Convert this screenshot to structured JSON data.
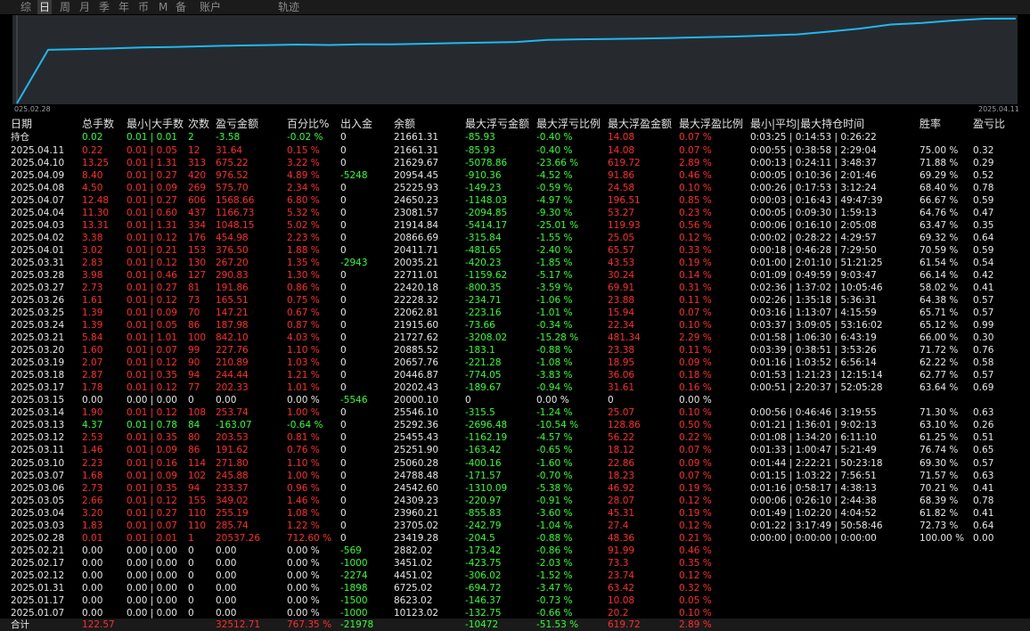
{
  "tabs": [
    {
      "label": "综",
      "active": false
    },
    {
      "label": "日",
      "active": true
    },
    {
      "label": "周",
      "active": false
    },
    {
      "label": "月",
      "active": false
    },
    {
      "label": "季",
      "active": false
    },
    {
      "label": "年",
      "active": false
    },
    {
      "label": "币",
      "active": false
    },
    {
      "label": "M",
      "active": false
    },
    {
      "label": "备",
      "active": false
    },
    {
      "label": "账户",
      "active": false
    },
    {
      "label": "轨迹",
      "active": false
    }
  ],
  "chart_data": {
    "type": "line",
    "x_start_label": "025.02.28",
    "x_end_label": "2025.04.11",
    "x": [
      "2025.02.28",
      "2025.03.03",
      "2025.03.04",
      "2025.03.05",
      "2025.03.06",
      "2025.03.07",
      "2025.03.10",
      "2025.03.11",
      "2025.03.12",
      "2025.03.13",
      "2025.03.14",
      "2025.03.15",
      "2025.03.17",
      "2025.03.18",
      "2025.03.19",
      "2025.03.20",
      "2025.03.21",
      "2025.03.24",
      "2025.03.25",
      "2025.03.26",
      "2025.03.27",
      "2025.03.28",
      "2025.03.31",
      "2025.04.01",
      "2025.04.02",
      "2025.04.03",
      "2025.04.04",
      "2025.04.07",
      "2025.04.08",
      "2025.04.09",
      "2025.04.10",
      "2025.04.11"
    ],
    "y": [
      20537.26,
      20823,
      21078,
      21427,
      21660,
      21906,
      22178,
      22370,
      22573,
      22410,
      22664,
      22664,
      22866,
      23111,
      23321,
      23549,
      24391,
      24579,
      24726,
      24892,
      25084,
      25375,
      25642,
      26021,
      26476,
      27524,
      28691,
      30260,
      30836,
      31813,
      32488,
      32520
    ],
    "line_color": "#1fb8f0"
  },
  "table": {
    "headers": [
      "日期",
      "总手数",
      "最小|大手数",
      "次数",
      "盈亏金额",
      "百分比%",
      "出入金",
      "余额",
      "最大浮亏金额",
      "最大浮亏比例",
      "最大浮盈金额",
      "最大浮盈比例",
      "最小|平均|最大持仓时间",
      "胜率",
      "盈亏比"
    ],
    "position_row": [
      "持仓",
      "0.02",
      "0.01 | 0.01",
      "2",
      "-3.58",
      "-0.02 %",
      "0",
      "21661.31",
      "-85.93",
      "-0.40 %",
      "14.08",
      "0.07 %",
      "0:03:25 | 0:14:53 | 0:26:22",
      "",
      ""
    ],
    "rows": [
      [
        "2025.04.11",
        "0.22",
        "0.01 | 0.05",
        "12",
        "31.64",
        "0.15 %",
        "0",
        "21661.31",
        "-85.93",
        "-0.40 %",
        "14.08",
        "0.07 %",
        "0:00:55 | 0:38:58 | 2:29:04",
        "75.00 %",
        "0.32"
      ],
      [
        "2025.04.10",
        "13.25",
        "0.01 | 1.31",
        "313",
        "675.22",
        "3.22 %",
        "0",
        "21629.67",
        "-5078.86",
        "-23.66 %",
        "619.72",
        "2.89 %",
        "0:00:13 | 0:24:11 | 3:48:37",
        "71.88 %",
        "0.29"
      ],
      [
        "2025.04.09",
        "8.40",
        "0.01 | 0.27",
        "420",
        "976.52",
        "4.89 %",
        "-5248",
        "20954.45",
        "-910.36",
        "-4.52 %",
        "91.86",
        "0.46 %",
        "0:00:05 | 0:10:36 | 2:01:46",
        "69.29 %",
        "0.52"
      ],
      [
        "2025.04.08",
        "4.50",
        "0.01 | 0.09",
        "269",
        "575.70",
        "2.34 %",
        "0",
        "25225.93",
        "-149.23",
        "-0.59 %",
        "24.58",
        "0.10 %",
        "0:00:26 | 0:17:53 | 3:12:24",
        "68.40 %",
        "0.78"
      ],
      [
        "2025.04.07",
        "12.48",
        "0.01 | 0.27",
        "606",
        "1568.66",
        "6.80 %",
        "0",
        "24650.23",
        "-1148.03",
        "-4.97 %",
        "196.51",
        "0.85 %",
        "0:00:03 | 0:16:43 | 49:47:39",
        "66.67 %",
        "0.59"
      ],
      [
        "2025.04.04",
        "11.30",
        "0.01 | 0.60",
        "437",
        "1166.73",
        "5.32 %",
        "0",
        "23081.57",
        "-2094.85",
        "-9.30 %",
        "53.27",
        "0.23 %",
        "0:00:05 | 0:09:30 | 1:59:13",
        "64.76 %",
        "0.47"
      ],
      [
        "2025.04.03",
        "13.31",
        "0.01 | 1.31",
        "334",
        "1048.15",
        "5.02 %",
        "0",
        "21914.84",
        "-5414.17",
        "-25.01 %",
        "119.93",
        "0.56 %",
        "0:00:06 | 0:16:10 | 2:05:08",
        "63.47 %",
        "0.35"
      ],
      [
        "2025.04.02",
        "3.38",
        "0.01 | 0.12",
        "176",
        "454.98",
        "2.23 %",
        "0",
        "20866.69",
        "-315.84",
        "-1.55 %",
        "25.05",
        "0.12 %",
        "0:00:02 | 0:28:22 | 4:29:57",
        "69.32 %",
        "0.64"
      ],
      [
        "2025.04.01",
        "3.02",
        "0.01 | 0.21",
        "153",
        "376.50",
        "1.88 %",
        "0",
        "20411.71",
        "-481.65",
        "-2.40 %",
        "65.57",
        "0.33 %",
        "0:00:18 | 0:46:28 | 7:29:50",
        "70.59 %",
        "0.59"
      ],
      [
        "2025.03.31",
        "2.83",
        "0.01 | 0.12",
        "130",
        "267.20",
        "1.35 %",
        "-2943",
        "20035.21",
        "-420.23",
        "-1.85 %",
        "43.53",
        "0.19 %",
        "0:01:00 | 2:01:10 | 51:21:25",
        "61.54 %",
        "0.54"
      ],
      [
        "2025.03.28",
        "3.98",
        "0.01 | 0.46",
        "127",
        "290.83",
        "1.30 %",
        "0",
        "22711.01",
        "-1159.62",
        "-5.17 %",
        "30.24",
        "0.14 %",
        "0:01:09 | 0:49:59 | 9:03:47",
        "66.14 %",
        "0.42"
      ],
      [
        "2025.03.27",
        "2.73",
        "0.01 | 0.27",
        "81",
        "191.86",
        "0.86 %",
        "0",
        "22420.18",
        "-800.35",
        "-3.59 %",
        "69.91",
        "0.31 %",
        "0:02:36 | 1:37:02 | 10:05:46",
        "58.02 %",
        "0.41"
      ],
      [
        "2025.03.26",
        "1.61",
        "0.01 | 0.12",
        "73",
        "165.51",
        "0.75 %",
        "0",
        "22228.32",
        "-234.71",
        "-1.06 %",
        "23.88",
        "0.11 %",
        "0:02:26 | 1:35:18 | 5:36:31",
        "64.38 %",
        "0.57"
      ],
      [
        "2025.03.25",
        "1.39",
        "0.01 | 0.09",
        "70",
        "147.21",
        "0.67 %",
        "0",
        "22062.81",
        "-223.16",
        "-1.01 %",
        "15.94",
        "0.07 %",
        "0:03:16 | 1:13:07 | 4:15:59",
        "65.71 %",
        "0.57"
      ],
      [
        "2025.03.24",
        "1.39",
        "0.01 | 0.05",
        "86",
        "187.98",
        "0.87 %",
        "0",
        "21915.60",
        "-73.66",
        "-0.34 %",
        "22.34",
        "0.10 %",
        "0:03:37 | 3:09:05 | 53:16:02",
        "65.12 %",
        "0.99"
      ],
      [
        "2025.03.21",
        "5.84",
        "0.01 | 1.01",
        "100",
        "842.10",
        "4.03 %",
        "0",
        "21727.62",
        "-3208.02",
        "-15.28 %",
        "481.34",
        "2.29 %",
        "0:01:58 | 1:06:30 | 6:43:19",
        "66.00 %",
        "0.30"
      ],
      [
        "2025.03.20",
        "1.60",
        "0.01 | 0.07",
        "99",
        "227.76",
        "1.10 %",
        "0",
        "20885.52",
        "-183.1",
        "-0.88 %",
        "23.38",
        "0.11 %",
        "0:03:39 | 0:38:51 | 3:53:26",
        "71.72 %",
        "0.76"
      ],
      [
        "2025.03.19",
        "2.07",
        "0.01 | 0.12",
        "90",
        "210.89",
        "1.03 %",
        "0",
        "20657.76",
        "-221.28",
        "-1.08 %",
        "18.95",
        "0.09 %",
        "0:01:16 | 1:03:52 | 6:56:14",
        "62.22 %",
        "0.58"
      ],
      [
        "2025.03.18",
        "2.87",
        "0.01 | 0.35",
        "94",
        "244.44",
        "1.21 %",
        "0",
        "20446.87",
        "-774.05",
        "-3.83 %",
        "36.06",
        "0.18 %",
        "0:01:53 | 1:21:23 | 12:15:14",
        "62.77 %",
        "0.57"
      ],
      [
        "2025.03.17",
        "1.78",
        "0.01 | 0.12",
        "77",
        "202.33",
        "1.01 %",
        "0",
        "20202.43",
        "-189.67",
        "-0.94 %",
        "31.61",
        "0.16 %",
        "0:00:51 | 2:20:37 | 52:05:28",
        "63.64 %",
        "0.69"
      ],
      [
        "2025.03.15",
        "0.00",
        "0.00 | 0.00",
        "0",
        "0.00",
        "0.00 %",
        "-5546",
        "20000.10",
        "0",
        "0.00 %",
        "0",
        "0.00 %",
        "",
        "",
        ""
      ],
      [
        "2025.03.14",
        "1.90",
        "0.01 | 0.12",
        "108",
        "253.74",
        "1.00 %",
        "0",
        "25546.10",
        "-315.5",
        "-1.24 %",
        "25.07",
        "0.10 %",
        "0:00:56 | 0:46:46 | 3:19:55",
        "71.30 %",
        "0.63"
      ],
      [
        "2025.03.13",
        "4.37",
        "0.01 | 0.78",
        "84",
        "-163.07",
        "-0.64 %",
        "0",
        "25292.36",
        "-2696.48",
        "-10.54 %",
        "128.86",
        "0.50 %",
        "0:01:21 | 1:36:01 | 9:02:13",
        "63.10 %",
        "0.26"
      ],
      [
        "2025.03.12",
        "2.53",
        "0.01 | 0.35",
        "80",
        "203.53",
        "0.81 %",
        "0",
        "25455.43",
        "-1162.19",
        "-4.57 %",
        "56.22",
        "0.22 %",
        "0:01:08 | 1:34:20 | 6:11:10",
        "61.25 %",
        "0.51"
      ],
      [
        "2025.03.11",
        "1.46",
        "0.01 | 0.09",
        "86",
        "191.62",
        "0.76 %",
        "0",
        "25251.90",
        "-163.42",
        "-0.65 %",
        "18.12",
        "0.07 %",
        "0:01:33 | 1:00:47 | 5:21:49",
        "76.74 %",
        "0.65"
      ],
      [
        "2025.03.10",
        "2.23",
        "0.01 | 0.16",
        "114",
        "271.80",
        "1.10 %",
        "0",
        "25060.28",
        "-400.16",
        "-1.60 %",
        "22.86",
        "0.09 %",
        "0:01:44 | 2:22:21 | 50:23:18",
        "69.30 %",
        "0.57"
      ],
      [
        "2025.03.07",
        "1.68",
        "0.01 | 0.09",
        "102",
        "245.88",
        "1.00 %",
        "0",
        "24788.48",
        "-171.57",
        "-0.70 %",
        "18.23",
        "0.07 %",
        "0:01:15 | 1:03:22 | 7:56:51",
        "71.57 %",
        "0.63"
      ],
      [
        "2025.03.06",
        "2.73",
        "0.01 | 0.35",
        "94",
        "233.37",
        "0.96 %",
        "0",
        "24542.60",
        "-1310.09",
        "-5.38 %",
        "46.92",
        "0.19 %",
        "0:01:16 | 0:58:17 | 4:38:13",
        "70.21 %",
        "0.41"
      ],
      [
        "2025.03.05",
        "2.66",
        "0.01 | 0.12",
        "155",
        "349.02",
        "1.46 %",
        "0",
        "24309.23",
        "-220.97",
        "-0.91 %",
        "28.07",
        "0.12 %",
        "0:00:06 | 0:26:10 | 2:44:38",
        "68.39 %",
        "0.78"
      ],
      [
        "2025.03.04",
        "3.20",
        "0.01 | 0.27",
        "110",
        "255.19",
        "1.08 %",
        "0",
        "23960.21",
        "-855.83",
        "-3.60 %",
        "45.31",
        "0.19 %",
        "0:01:49 | 1:02:20 | 4:04:52",
        "61.82 %",
        "0.41"
      ],
      [
        "2025.03.03",
        "1.83",
        "0.01 | 0.07",
        "110",
        "285.74",
        "1.22 %",
        "0",
        "23705.02",
        "-242.79",
        "-1.04 %",
        "27.4",
        "0.12 %",
        "0:01:22 | 3:17:49 | 50:58:46",
        "72.73 %",
        "0.64"
      ],
      [
        "2025.02.28",
        "0.01",
        "0.01 | 0.01",
        "1",
        "20537.26",
        "712.60 %",
        "0",
        "23419.28",
        "-204.5",
        "-0.88 %",
        "48.36",
        "0.21 %",
        "0:00:00 | 0:00:00 | 0:00:00",
        "100.00 %",
        "0.00"
      ],
      [
        "2025.02.21",
        "0.00",
        "0.00 | 0.00",
        "0",
        "0.00",
        "0.00 %",
        "-569",
        "2882.02",
        "-173.42",
        "-0.86 %",
        "91.99",
        "0.46 %",
        "",
        "",
        ""
      ],
      [
        "2025.02.17",
        "0.00",
        "0.00 | 0.00",
        "0",
        "0.00",
        "0.00 %",
        "-1000",
        "3451.02",
        "-423.75",
        "-2.03 %",
        "73.3",
        "0.35 %",
        "",
        "",
        ""
      ],
      [
        "2025.02.12",
        "0.00",
        "0.00 | 0.00",
        "0",
        "0.00",
        "0.00 %",
        "-2274",
        "4451.02",
        "-306.02",
        "-1.52 %",
        "23.74",
        "0.12 %",
        "",
        "",
        ""
      ],
      [
        "2025.01.31",
        "0.00",
        "0.00 | 0.00",
        "0",
        "0.00",
        "0.00 %",
        "-1898",
        "6725.02",
        "-694.72",
        "-3.47 %",
        "63.42",
        "0.32 %",
        "",
        "",
        ""
      ],
      [
        "2025.01.17",
        "0.00",
        "0.00 | 0.00",
        "0",
        "0.00",
        "0.00 %",
        "-1500",
        "8623.02",
        "-146.37",
        "-0.73 %",
        "10.08",
        "0.05 %",
        "",
        "",
        ""
      ],
      [
        "2025.01.07",
        "0.00",
        "0.00 | 0.00",
        "0",
        "0.00",
        "0.00 %",
        "-1000",
        "10123.02",
        "-132.75",
        "-0.66 %",
        "20.2",
        "0.10 %",
        "",
        "",
        ""
      ]
    ],
    "totals": [
      "合计",
      "122.57",
      "",
      "",
      "32512.71",
      "767.35 %",
      "-21978",
      "",
      "-10472",
      "-51.53 %",
      "619.72",
      "2.89 %",
      "",
      "",
      ""
    ]
  }
}
